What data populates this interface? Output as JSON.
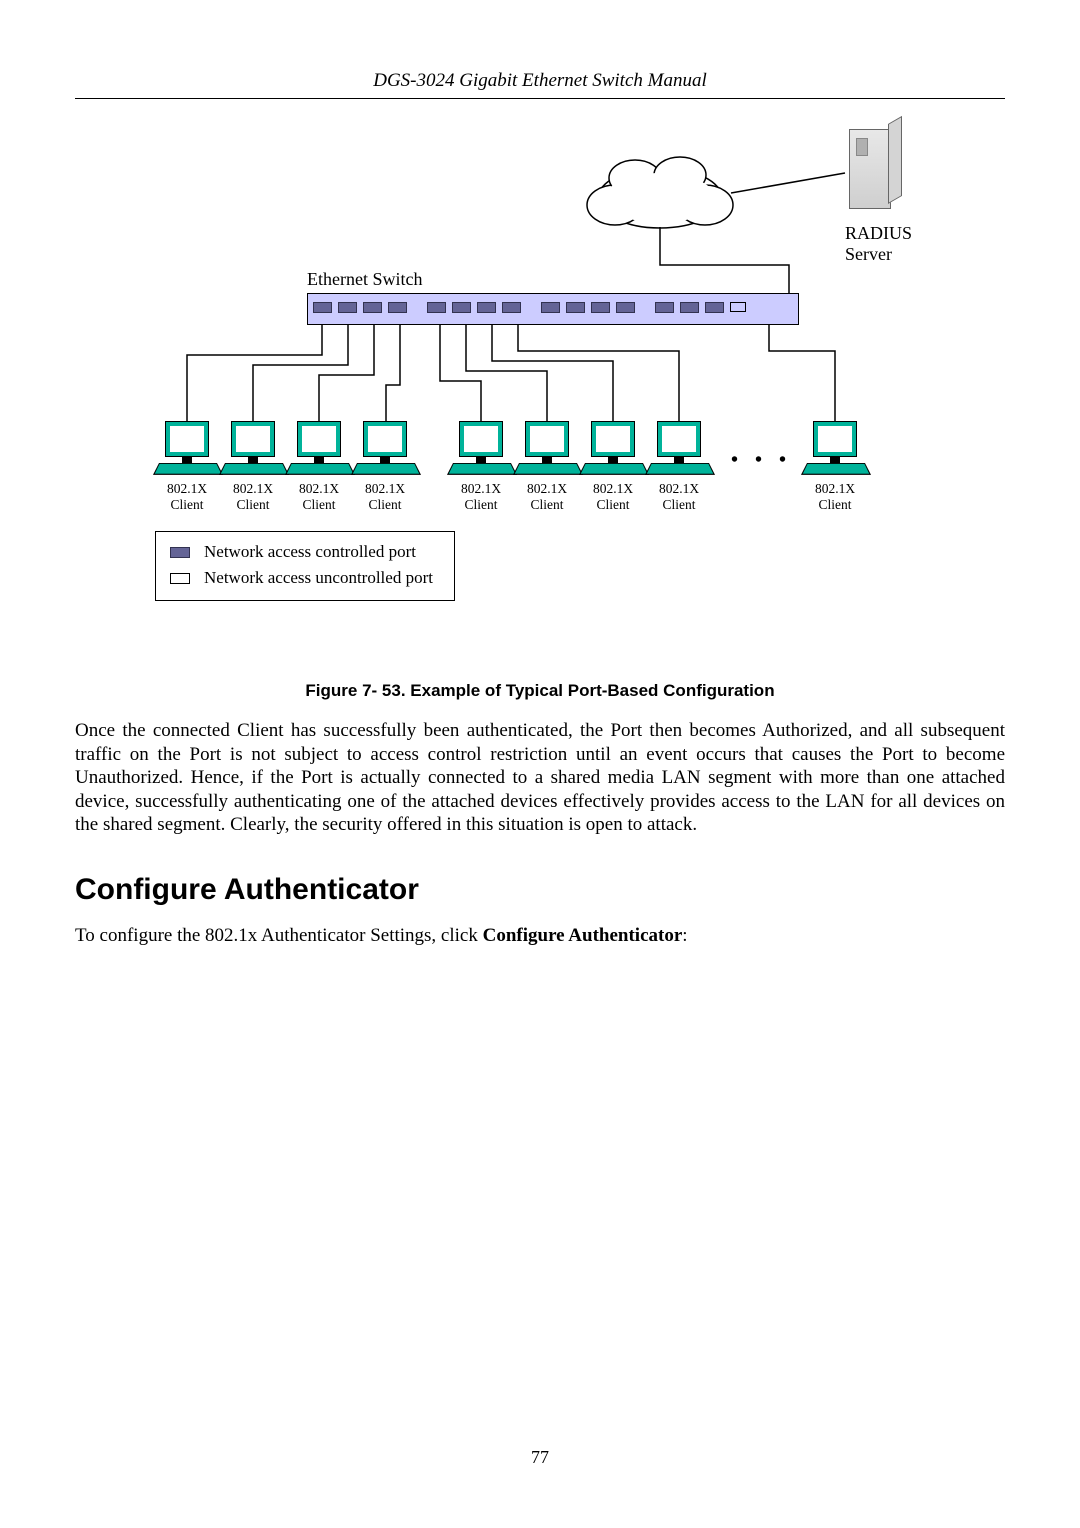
{
  "header": "DGS-3024 Gigabit Ethernet Switch Manual",
  "diagram": {
    "switch_label": "Ethernet Switch",
    "radius_label_line1": "RADIUS",
    "radius_label_line2": "Server",
    "client_label_line1": "802.1X",
    "client_label_line2": "Client",
    "dots": "…",
    "legend": {
      "controlled": "Network access controlled port",
      "uncontrolled": "Network access uncontrolled port"
    }
  },
  "caption": "Figure 7- 53. Example of Typical Port-Based Configuration",
  "paragraph": "Once the connected Client has successfully been authenticated, the Port then becomes Authorized, and all subsequent traffic on the Port is not subject to access control restriction until an event occurs that causes the Port to become Unauthorized. Hence, if the Port is actually connected to a shared media LAN segment with more than one attached device, successfully authenticating one of the attached devices effectively provides access to the LAN for all devices on the shared segment. Clearly, the security offered in this situation is open to attack.",
  "section_heading": "Configure Authenticator",
  "instruction_prefix": "To configure the 802.1x Authenticator Settings, click ",
  "instruction_link": "Configure Authenticator",
  "instruction_suffix": ":",
  "page_number": "77"
}
